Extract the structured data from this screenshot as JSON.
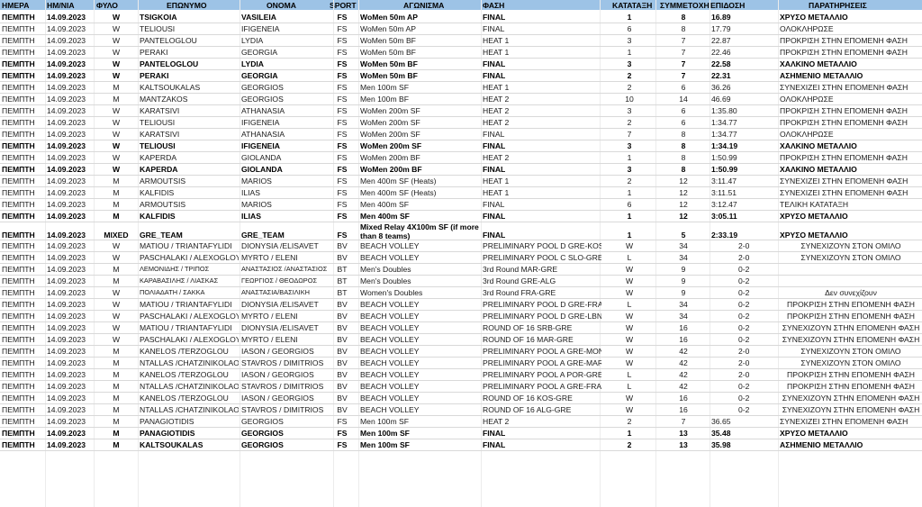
{
  "headers": [
    "ΗΜΕΡΑ",
    "ΗΜ/ΝΙΑ",
    "ΦΥΛΟ",
    "ΕΠΩΝΥΜΟ",
    "ΟΝΟΜΑ",
    "SPORT",
    "ΑΓΩΝΙΣΜΑ",
    "ΦΑΣΗ",
    "ΚΑΤΑΤΑΞΗ",
    "ΣΥΜΜΕΤΟΧΗ",
    "ΕΠΙΔΟΣΗ",
    "ΠΑΡΑΤΗΡΗΣΕΙΣ"
  ],
  "rows": [
    {
      "bold": true,
      "c": [
        "ΠΕΜΠΤΗ",
        "14.09.2023",
        "W",
        "TSIGKOIA",
        "VASILEIA",
        "FS",
        "WoMen 50m AP",
        "FINAL",
        "1",
        "8",
        "16.89",
        "ΧΡΥΣΟ ΜΕΤΑΛΛΙΟ"
      ]
    },
    {
      "bold": false,
      "c": [
        "ΠΕΜΠΤΗ",
        "14.09.2023",
        "W",
        "TELIOUSI",
        "IFIGENEIA",
        "FS",
        "WoMen 50m AP",
        "FINAL",
        "6",
        "8",
        "17.79",
        "ΟΛΟΚΛΗΡΩΣΕ"
      ]
    },
    {
      "bold": false,
      "c": [
        "ΠΕΜΠΤΗ",
        "14.09.2023",
        "W",
        "PANTELOGLOU",
        "LYDIA",
        "FS",
        "WoMen 50m BF",
        "HEAT 1",
        "3",
        "7",
        "22.87",
        "ΠΡΟΚΡΙΣΗ ΣΤΗΝ ΕΠΟΜΕΝΗ ΦΑΣΗ"
      ]
    },
    {
      "bold": false,
      "c": [
        "ΠΕΜΠΤΗ",
        "14.09.2023",
        "W",
        "PERAKI",
        "GEORGIA",
        "FS",
        "WoMen 50m BF",
        "HEAT 1",
        "1",
        "7",
        "22.46",
        "ΠΡΟΚΡΙΣΗ ΣΤΗΝ ΕΠΟΜΕΝΗ ΦΑΣΗ"
      ]
    },
    {
      "bold": true,
      "c": [
        "ΠΕΜΠΤΗ",
        "14.09.2023",
        "W",
        "PANTELOGLOU",
        "LYDIA",
        "FS",
        "WoMen 50m BF",
        "FINAL",
        "3",
        "7",
        "22.58",
        "ΧΑΛΚΙΝΟ ΜΕΤΑΛΛΙΟ"
      ]
    },
    {
      "bold": true,
      "c": [
        "ΠΕΜΠΤΗ",
        "14.09.2023",
        "W",
        "PERAKI",
        "GEORGIA",
        "FS",
        "WoMen 50m BF",
        "FINAL",
        "2",
        "7",
        "22.31",
        "ΑΣΗΜΕΝΙΟ ΜΕΤΑΛΛΙΟ"
      ]
    },
    {
      "bold": false,
      "c": [
        "ΠΕΜΠΤΗ",
        "14.09.2023",
        "M",
        "KALTSOUKALAS",
        "GEORGIOS",
        "FS",
        "Men 100m SF",
        "HEAT 1",
        "2",
        "6",
        "36.26",
        "ΣΥΝΕΧΙΖΕΙ ΣΤΗΝ ΕΠΟΜΕΝΗ ΦΑΣΗ"
      ]
    },
    {
      "bold": false,
      "c": [
        "ΠΕΜΠΤΗ",
        "14.09.2023",
        "M",
        "MANTZAKOS",
        "GEORGIOS",
        "FS",
        "Men 100m BF",
        "HEAT 2",
        "10",
        "14",
        "46.69",
        "ΟΛΟΚΛΗΡΩΣΕ"
      ]
    },
    {
      "bold": false,
      "c": [
        "ΠΕΜΠΤΗ",
        "14.09.2023",
        "W",
        "KARATSIVI",
        "ATHANASIA",
        "FS",
        "WoMen 200m SF",
        "HEAT 2",
        "3",
        "6",
        "1:35.80",
        "ΠΡΟΚΡΙΣΗ ΣΤΗΝ ΕΠΟΜΕΝΗ ΦΑΣΗ"
      ]
    },
    {
      "bold": false,
      "c": [
        "ΠΕΜΠΤΗ",
        "14.09.2023",
        "W",
        "TELIOUSI",
        "IFIGENEIA",
        "FS",
        "WoMen 200m SF",
        "HEAT 2",
        "2",
        "6",
        "1:34.77",
        "ΠΡΟΚΡΙΣΗ ΣΤΗΝ ΕΠΟΜΕΝΗ ΦΑΣΗ"
      ]
    },
    {
      "bold": false,
      "c": [
        "ΠΕΜΠΤΗ",
        "14.09.2023",
        "W",
        "KARATSIVI",
        "ATHANASIA",
        "FS",
        "WoMen 200m SF",
        "FINAL",
        "7",
        "8",
        "1:34.77",
        "ΟΛΟΚΛΗΡΩΣΕ"
      ]
    },
    {
      "bold": true,
      "c": [
        "ΠΕΜΠΤΗ",
        "14.09.2023",
        "W",
        "TELIOUSI",
        "IFIGENEIA",
        "FS",
        "WoMen 200m SF",
        "FINAL",
        "3",
        "8",
        "1:34.19",
        "ΧΑΛΚΙΝΟ ΜΕΤΑΛΛΙΟ"
      ]
    },
    {
      "bold": false,
      "c": [
        "ΠΕΜΠΤΗ",
        "14.09.2023",
        "W",
        "KAPERDA",
        "GIOLANDA",
        "FS",
        "WoMen 200m BF",
        "HEAT 2",
        "1",
        "8",
        "1:50.99",
        "ΠΡΟΚΡΙΣΗ ΣΤΗΝ ΕΠΟΜΕΝΗ ΦΑΣΗ"
      ]
    },
    {
      "bold": true,
      "c": [
        "ΠΕΜΠΤΗ",
        "14.09.2023",
        "W",
        "KAPERDA",
        "GIOLANDA",
        "FS",
        "WoMen 200m BF",
        "FINAL",
        "3",
        "8",
        "1:50.99",
        "ΧΑΛΚΙΝΟ ΜΕΤΑΛΛΙΟ"
      ]
    },
    {
      "bold": false,
      "c": [
        "ΠΕΜΠΤΗ",
        "14.09.2023",
        "M",
        "ARMOUTSIS",
        "MARIOS",
        "FS",
        "Men 400m SF (Heats)",
        "HEAT 1",
        "2",
        "12",
        "3:11.47",
        "ΣΥΝΕΧΙΖΕΙ ΣΤΗΝ ΕΠΟΜΕΝΗ ΦΑΣΗ"
      ]
    },
    {
      "bold": false,
      "c": [
        "ΠΕΜΠΤΗ",
        "14.09.2023",
        "M",
        "KALFIDIS",
        "ILIAS",
        "FS",
        "Men 400m SF (Heats)",
        "HEAT 1",
        "1",
        "12",
        "3:11.51",
        "ΣΥΝΕΧΙΖΕΙ ΣΤΗΝ ΕΠΟΜΕΝΗ ΦΑΣΗ"
      ]
    },
    {
      "bold": false,
      "c": [
        "ΠΕΜΠΤΗ",
        "14.09.2023",
        "M",
        "ARMOUTSIS",
        "MARIOS",
        "FS",
        "Men 400m SF",
        "FINAL",
        "6",
        "12",
        "3:12.47",
        "ΤΕΛΙΚΗ ΚΑΤΑΤΑΞΗ"
      ]
    },
    {
      "bold": true,
      "c": [
        "ΠΕΜΠΤΗ",
        "14.09.2023",
        "M",
        "KALFIDIS",
        "ILIAS",
        "FS",
        "Men 400m SF",
        "FINAL",
        "1",
        "12",
        "3:05.11",
        "ΧΡΥΣΟ ΜΕΤΑΛΛΙΟ"
      ]
    },
    {
      "bold": true,
      "c": [
        "ΠΕΜΠΤΗ",
        "14.09.2023",
        "MIXED",
        "GRE_TEAM",
        "GRE_TEAM",
        "FS",
        "Mixed Relay 4X100m SF (if more than 8 teams)",
        "FINAL",
        "1",
        "5",
        "2:33.19",
        "ΧΡΥΣΟ ΜΕΤΑΛΛΙΟ"
      ]
    },
    {
      "bold": false,
      "c": [
        "ΠΕΜΠΤΗ",
        "14.09.2023",
        "W",
        "MATIOU / TRIANTAFYLIDI",
        "DIONYSIA /ELISAVET",
        "BV",
        "BEACH VOLLEY",
        "PRELIMINARY POOL D GRE-KOS",
        "W",
        "34",
        "2-0",
        "ΣΥΝΕΧΙΖΟΥΝ ΣΤΟΝ ΟΜΙΛΟ"
      ]
    },
    {
      "bold": false,
      "c": [
        "ΠΕΜΠΤΗ",
        "14.09.2023",
        "W",
        "PASCHALAKI / ALEXOGLOY",
        "MYRTO / ELENI",
        "BV",
        "BEACH VOLLEY",
        "PRELIMINARY POOL C SLO-GRE",
        "L",
        "34",
        "2-0",
        "ΣΥΝΕΧΙΖΟΥΝ ΣΤΟΝ ΟΜΙΛΟ"
      ]
    },
    {
      "bold": false,
      "c": [
        "ΠΕΜΠΤΗ",
        "14.09.2023",
        "M",
        "ΛΕΜΟΝΙΔΗΣ / ΤΡΙΠΟΣ",
        "ΑΝΑΣΤΑΣΙΟΣ /ΑΝΑΣΤΑΣΙΟΣ",
        "BT",
        "Men's Doubles",
        "3rd Round MAR-GRE",
        "W",
        "9",
        "0-2",
        ""
      ]
    },
    {
      "bold": false,
      "c": [
        "ΠΕΜΠΤΗ",
        "14.09.2023",
        "M",
        "ΚΑΡΑΒΑΣΙΛΗΣ / ΛΙΑΣΚΑΣ",
        "ΓΕΩΡΓΙΟΣ / ΘΕΟΔΩΡΟΣ",
        "BT",
        "Men's Doubles",
        "3rd Round GRE-ALG",
        "W",
        "9",
        "0-2",
        ""
      ]
    },
    {
      "bold": false,
      "c": [
        "ΠΕΜΠΤΗ",
        "14.09.2023",
        "W",
        "ΠΟΛΙΑΔΑΤΗ / ΣΑΚΚΑ",
        "ΑΝΑΣΤΑΣΙΑ/ΒΑΣΙΛΙΚΗ",
        "BT",
        "Women's Doubles",
        "3rd Round FRA-GRE",
        "W",
        "9",
        "0-2",
        "Δεν συνεχίζουν"
      ]
    },
    {
      "bold": false,
      "c": [
        "ΠΕΜΠΤΗ",
        "14.09.2023",
        "W",
        "MATIOU / TRIANTAFYLIDI",
        "DIONYSIA /ELISAVET",
        "BV",
        "BEACH VOLLEY",
        "PRELIMINARY POOL D GRE-FRA",
        "L",
        "34",
        "0-2",
        "ΠΡΟΚΡΙΣΗ ΣΤΗΝ ΕΠΟΜΕΝΗ ΦΑΣΗ"
      ]
    },
    {
      "bold": false,
      "c": [
        "ΠΕΜΠΤΗ",
        "14.09.2023",
        "W",
        "PASCHALAKI / ALEXOGLOY",
        "MYRTO / ELENI",
        "BV",
        "BEACH VOLLEY",
        "PRELIMINARY POOL D GRE-LBN",
        "W",
        "34",
        "0-2",
        "ΠΡΟΚΡΙΣΗ ΣΤΗΝ ΕΠΟΜΕΝΗ ΦΑΣΗ"
      ]
    },
    {
      "bold": false,
      "c": [
        "ΠΕΜΠΤΗ",
        "14.09.2023",
        "W",
        "MATIOU / TRIANTAFYLIDI",
        "DIONYSIA /ELISAVET",
        "BV",
        "BEACH VOLLEY",
        "ROUND OF 16 SRB-GRE",
        "W",
        "16",
        "0-2",
        "ΣΥΝΕΧΙΖΟΥΝ ΣΤΗΝ ΕΠΟΜΕΝΗ ΦΑΣΗ"
      ]
    },
    {
      "bold": false,
      "c": [
        "ΠΕΜΠΤΗ",
        "14.09.2023",
        "W",
        "PASCHALAKI / ALEXOGLOY",
        "MYRTO / ELENI",
        "BV",
        "BEACH VOLLEY",
        "ROUND OF 16 MAR-GRE",
        "W",
        "16",
        "0-2",
        "ΣΥΝΕΧΙΖΟΥΝ ΣΤΗΝ ΕΠΟΜΕΝΗ ΦΑΣΗ"
      ]
    },
    {
      "bold": false,
      "c": [
        "ΠΕΜΠΤΗ",
        "14.09.2023",
        "M",
        "KANELOS /TERZOGLOU",
        "IASON / GEORGIOS",
        "BV",
        "BEACH VOLLEY",
        "PRELIMINARY POOL A GRE-MON",
        "W",
        "42",
        "2-0",
        "ΣΥΝΕΧΙΖΟΥΝ ΣΤΟΝ ΟΜΙΛΟ"
      ]
    },
    {
      "bold": false,
      "c": [
        "ΠΕΜΠΤΗ",
        "14.09.2023",
        "M",
        "NTALLAS /CHATZINIKOLAOU",
        "STAVROS / DIMITRIOS",
        "BV",
        "BEACH VOLLEY",
        "PRELIMINARY POOL A GRE-MAR",
        "W",
        "42",
        "2-0",
        "ΣΥΝΕΧΙΖΟΥΝ ΣΤΟΝ ΟΜΙΛΟ"
      ]
    },
    {
      "bold": false,
      "c": [
        "ΠΕΜΠΤΗ",
        "14.09.2023",
        "M",
        "KANELOS /TERZOGLOU",
        "IASON / GEORGIOS",
        "BV",
        "BEACH VOLLEY",
        "PRELIMINARY POOL A POR-GRE",
        "L",
        "42",
        "2-0",
        "ΠΡΟΚΡΙΣΗ ΣΤΗΝ ΕΠΟΜΕΝΗ ΦΑΣΗ"
      ]
    },
    {
      "bold": false,
      "c": [
        "ΠΕΜΠΤΗ",
        "14.09.2023",
        "M",
        "NTALLAS /CHATZINIKOLAOU",
        "STAVROS / DIMITRIOS",
        "BV",
        "BEACH VOLLEY",
        "PRELIMINARY POOL A GRE-FRA",
        "L",
        "42",
        "0-2",
        "ΠΡΟΚΡΙΣΗ ΣΤΗΝ ΕΠΟΜΕΝΗ ΦΑΣΗ"
      ]
    },
    {
      "bold": false,
      "c": [
        "ΠΕΜΠΤΗ",
        "14.09.2023",
        "M",
        "KANELOS /TERZOGLOU",
        "IASON / GEORGIOS",
        "BV",
        "BEACH VOLLEY",
        "ROUND OF 16 KOS-GRE",
        "W",
        "16",
        "0-2",
        "ΣΥΝΕΧΙΖΟΥΝ ΣΤΗΝ ΕΠΟΜΕΝΗ ΦΑΣΗ"
      ]
    },
    {
      "bold": false,
      "c": [
        "ΠΕΜΠΤΗ",
        "14.09.2023",
        "M",
        "NTALLAS /CHATZINIKOLAOU",
        "STAVROS / DIMITRIOS",
        "BV",
        "BEACH VOLLEY",
        "ROUND OF 16 ALG-GRE",
        "W",
        "16",
        "0-2",
        "ΣΥΝΕΧΙΖΟΥΝ ΣΤΗΝ ΕΠΟΜΕΝΗ ΦΑΣΗ"
      ]
    },
    {
      "bold": false,
      "c": [
        "ΠΕΜΠΤΗ",
        "14.09.2023",
        "M",
        "PANAGIOTIDIS",
        "GEORGIOS",
        "FS",
        "Men 100m SF",
        "HEAT 2",
        "2",
        "7",
        "36.65",
        "ΣΥΝΕΧΙΖΕΙ ΣΤΗΝ ΕΠΟΜΕΝΗ ΦΑΣΗ"
      ]
    },
    {
      "bold": true,
      "c": [
        "ΠΕΜΠΤΗ",
        "14.09.2023",
        "M",
        "PANAGIOTIDIS",
        "GEORGIOS",
        "FS",
        "Men 100m SF",
        "FINAL",
        "1",
        "13",
        "35.48",
        "ΧΡΥΣΟ ΜΕΤΑΛΛΙΟ"
      ]
    },
    {
      "bold": true,
      "c": [
        "ΠΕΜΠΤΗ",
        "14.09.2023",
        "M",
        "KALTSOUKALAS",
        "GEORGIOS",
        "FS",
        "Men 100m SF",
        "FINAL",
        "2",
        "13",
        "35.98",
        "ΑΣΗΜΕΝΙΟ ΜΕΤΑΛΛΙΟ"
      ]
    }
  ]
}
